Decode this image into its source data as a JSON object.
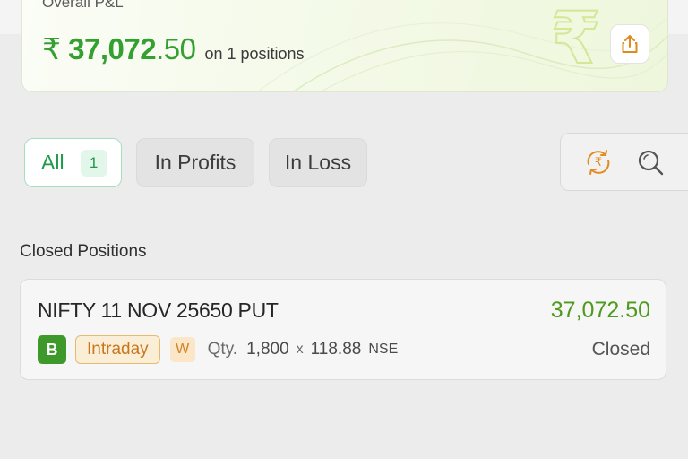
{
  "summary": {
    "label": "Overall P&L",
    "currency_symbol": "₹",
    "value_int": "37,072",
    "value_dec": ".50",
    "positions_text": "on 1 positions",
    "accent_color": "#35a032"
  },
  "share_button": {
    "icon": "share-icon"
  },
  "filters": {
    "all": {
      "label": "All",
      "count": "1"
    },
    "profits": {
      "label": "In Profits"
    },
    "loss": {
      "label": "In Loss"
    }
  },
  "tools": {
    "refresh_icon": "rupee-refresh-icon",
    "search_icon": "search-icon"
  },
  "closed_positions": {
    "title": "Closed Positions",
    "items": [
      {
        "symbol": "NIFTY 11 NOV 25650 PUT",
        "pnl": "37,072.50",
        "side": "B",
        "product": "Intraday",
        "expiry_flag": "W",
        "qty_label": "Qty.",
        "qty": "1,800",
        "multiplier": "x",
        "price": "118.88",
        "exchange": "NSE",
        "status": "Closed"
      }
    ]
  }
}
